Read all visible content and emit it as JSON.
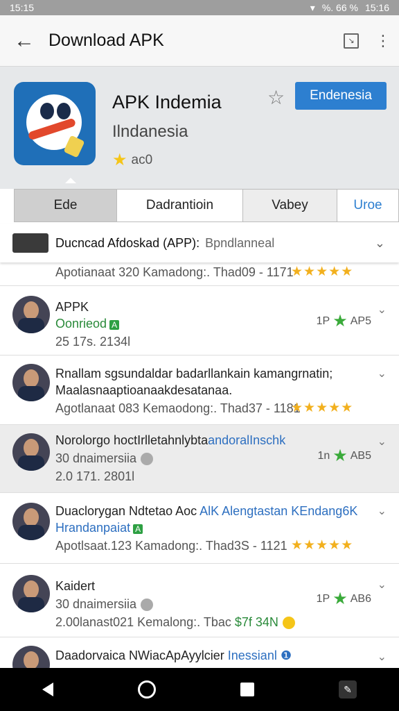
{
  "status_bar": {
    "time_left": "15:15",
    "right_text": "%. 66 %",
    "time_right": "15:16"
  },
  "app_bar": {
    "title": "Download APK"
  },
  "app": {
    "name": "APK Indemia",
    "developer": "Ilndanesia",
    "rating": "ac0",
    "install_label": "Endenesia"
  },
  "tabs": [
    "Ede",
    "Dadrantioin",
    "Vabey",
    "Uroe"
  ],
  "filter": {
    "label": "Ducncad Afdoskad (APP):",
    "value": "Bpndlanneal"
  },
  "list": [
    {
      "line1": "Apotianaat 320 Kamadong:. Thad09 - 1171",
      "stars": "★★★★★"
    },
    {
      "title": "APPK",
      "status": "Oonrieod",
      "badge": "A",
      "meta": "25 17s. 2134l",
      "right": "1P",
      "right2": "AP5"
    },
    {
      "title": "Rnallam sgsundaldar badarllankain kamangrnatin;",
      "title2": "Maalasnaaptioanaakdesatanaa.",
      "meta": "Agotlanaat 083 Kemaodong:. Thad37 - 1181",
      "stars": "★★★★★"
    },
    {
      "title": "Norolorgo hoctIrlletahnlybta",
      "title_blue": "andoralInschk",
      "sub": "30 dnaimersiia",
      "meta": "2.0 171. 2801l",
      "right": "1n",
      "right2": "AB5"
    },
    {
      "title": "Duaclorygan Ndtetao Aoc",
      "title_blue": "AlK Alengtastan KEndang6K",
      "sub": "Hrandanpaiat",
      "badge": "A",
      "meta": "Apotlsaat.123 Kamadong:. Thad3S - 1121",
      "stars": "★★★★★"
    },
    {
      "title": "Kaidert",
      "sub": "30 dnaimersiia",
      "meta": "2.00lanast021 Kemalong:. Tbac",
      "meta_green": "$7f 34N",
      "right": "1P",
      "right2": "AB6"
    },
    {
      "title": "Daadorvaica NWiacApAyylcier",
      "title_blue": "Inessianl"
    }
  ]
}
